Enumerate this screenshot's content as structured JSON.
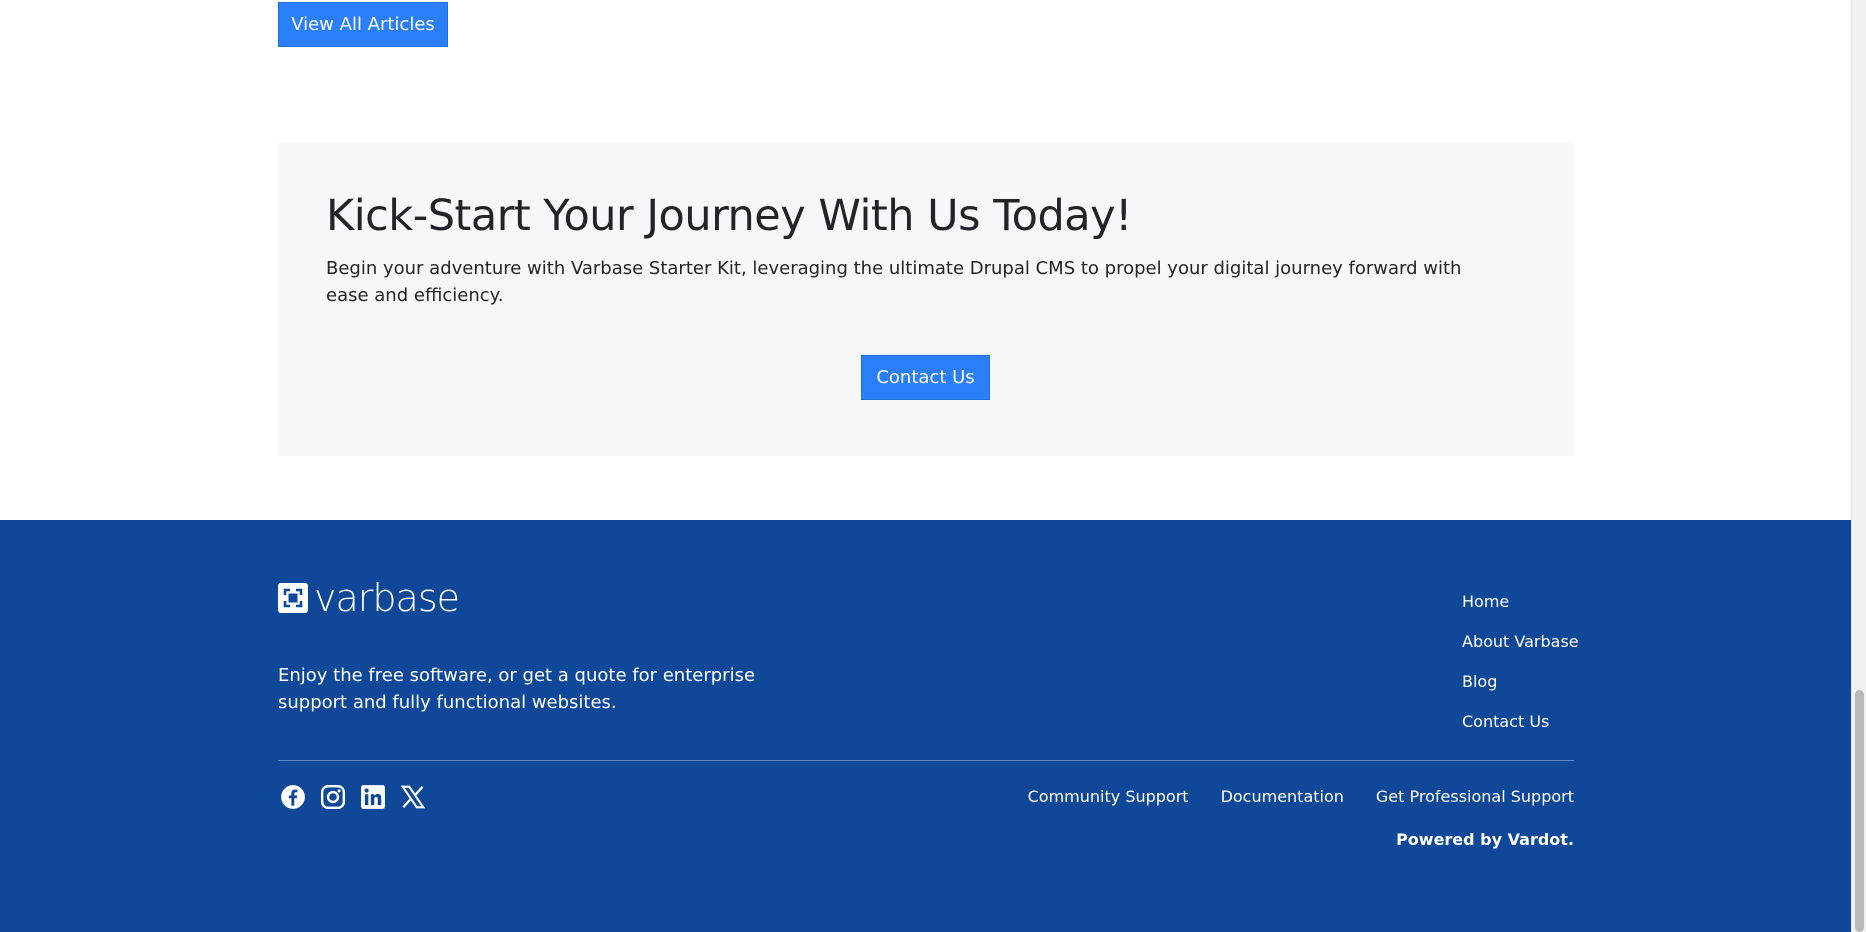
{
  "articles": {
    "view_all_label": "View All Articles"
  },
  "cta": {
    "title": "Kick-Start Your Journey With Us Today!",
    "text": "Begin your adventure with Varbase Starter Kit, leveraging the ultimate Drupal CMS to propel your digital journey forward with ease and efficiency.",
    "button_label": "Contact Us"
  },
  "footer": {
    "logo_text_light": "var",
    "logo_text_bold": "base",
    "description": "Enjoy the free software, or get a quote for enterprise support and fully functional websites.",
    "nav": [
      {
        "label": "Home"
      },
      {
        "label": "About Varbase"
      },
      {
        "label": "Blog"
      },
      {
        "label": "Contact Us"
      }
    ],
    "social_icons": [
      "facebook-icon",
      "instagram-icon",
      "linkedin-icon",
      "x-icon"
    ],
    "bottom_links": [
      {
        "label": "Community Support"
      },
      {
        "label": "Documentation"
      },
      {
        "label": "Get Professional Support"
      }
    ],
    "powered_by": "Powered by Vardot."
  },
  "colors": {
    "primary_button": "#2a7ef8",
    "footer_bg": "#0f4899",
    "cta_bg": "#f6f7f9"
  }
}
